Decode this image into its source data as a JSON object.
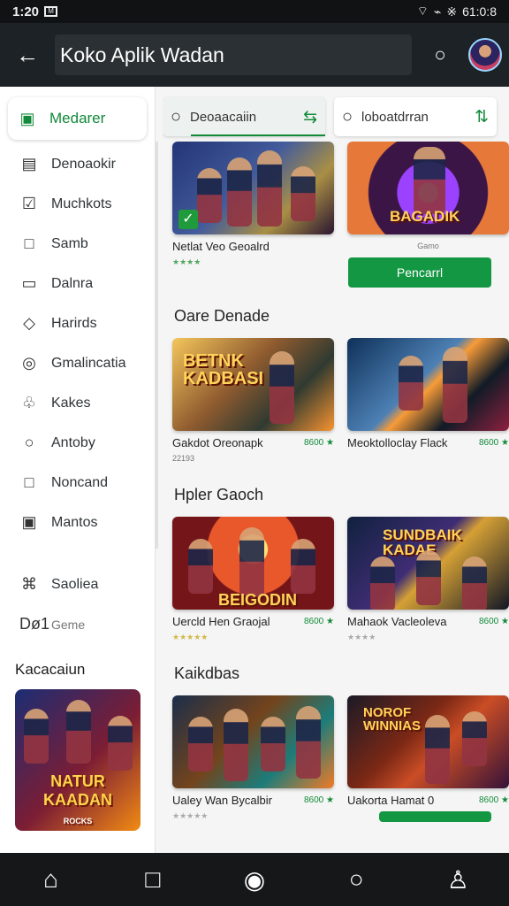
{
  "status": {
    "time": "1:20",
    "sim": "M",
    "signal": "⌁",
    "wifi": "⌔",
    "data_label": "※",
    "clock_right": "61:0:8"
  },
  "appbar": {
    "back": "←",
    "title": "Koko Aplik Wadan",
    "search": "○"
  },
  "drawer": {
    "active": {
      "label": "Medarer",
      "icon": "▣"
    },
    "items": [
      {
        "label": "Denoaokir",
        "icon": "▤"
      },
      {
        "label": "Muchkots",
        "icon": "☑"
      },
      {
        "label": "Samb",
        "icon": "□"
      },
      {
        "label": "Dalnra",
        "icon": "▭"
      },
      {
        "label": "Harirds",
        "icon": "◇"
      },
      {
        "label": "Gmalincatia",
        "icon": "◎"
      },
      {
        "label": "Kakes",
        "icon": "♧"
      },
      {
        "label": "Antoby",
        "icon": "○"
      },
      {
        "label": "Noncand",
        "icon": "□"
      },
      {
        "label": "Mantos",
        "icon": "▣"
      }
    ],
    "secondary": [
      {
        "label": "Saoliea",
        "icon": "⌘"
      },
      {
        "label": "Geme",
        "prefix": "Dø1"
      }
    ],
    "section": "Kacacaiun",
    "promo": {
      "line1": "NATUR KAADAN",
      "line2": "ROCKS"
    }
  },
  "search": [
    {
      "placeholder": "Deoaacaiin",
      "icon": "○",
      "action": "⇆"
    },
    {
      "placeholder": "loboatdrran",
      "icon": "○",
      "action": "⇅"
    }
  ],
  "featured": [
    {
      "title": "Netlat Veo Geoalrd",
      "rating": "★★★★",
      "image_text": ""
    },
    {
      "title": "Gamo",
      "button": "Pencarrl",
      "image_text": "BAGADIK"
    }
  ],
  "sections": [
    {
      "title": "Oare Denade",
      "games": [
        {
          "title": "Gakdot Oreonapk",
          "rating": "8600 ★",
          "meta": "22193",
          "image_text": "BETNK KADBASI"
        },
        {
          "title": "Meoktolloclay Flack",
          "rating": "8600 ★",
          "meta": "",
          "image_text": ""
        }
      ]
    },
    {
      "title": "Hpler Gaoch",
      "games": [
        {
          "title": "Uercld Hen Graojal",
          "rating": "8600 ★",
          "meta": "★★★★★",
          "image_text": "BEIGODIN"
        },
        {
          "title": "Mahaok Vacleoleva",
          "rating": "8600 ★",
          "meta": "★★★★",
          "image_text": "SUNDBAIK KADAE"
        }
      ]
    },
    {
      "title": "Kaikdbas",
      "games": [
        {
          "title": "Ualey Wan Bycalbir",
          "rating": "8600 ★",
          "meta": "★★★★★",
          "image_text": ""
        },
        {
          "title": "Uakorta Hamat 0",
          "rating": "8600 ★",
          "meta": "",
          "image_text": "NOROF WINNIAS"
        }
      ]
    }
  ],
  "bottom_nav": {
    "home": "⌂",
    "square": "□",
    "compass": "◉",
    "search": "○",
    "profile": "♙"
  }
}
